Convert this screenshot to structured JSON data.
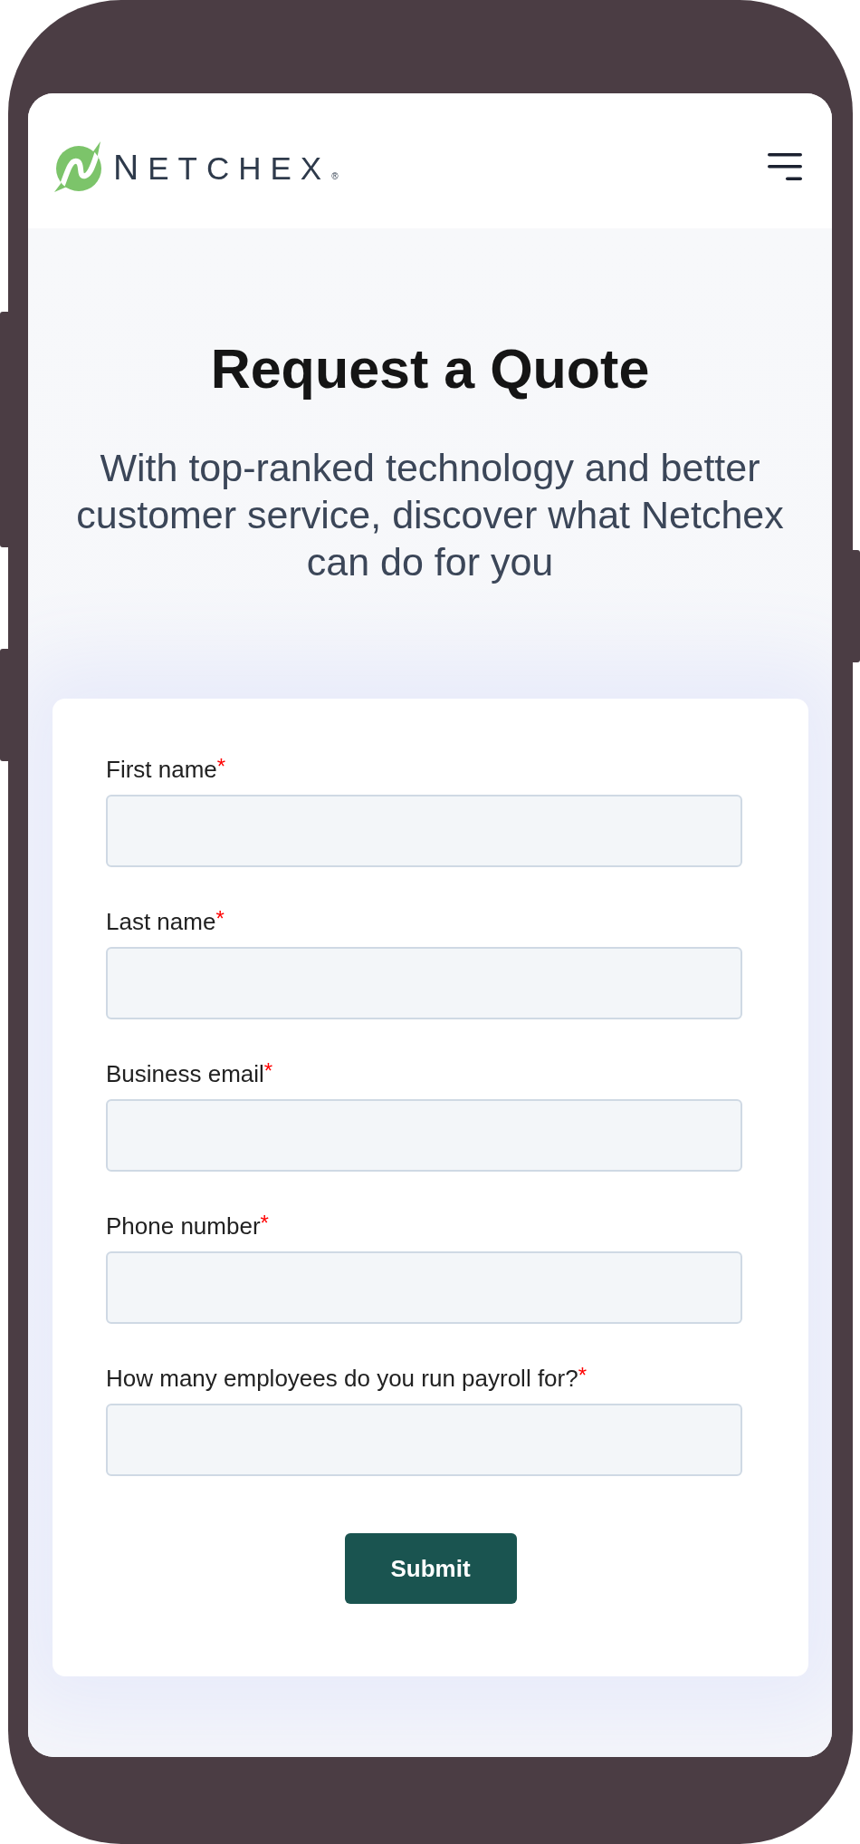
{
  "header": {
    "logo": {
      "wordmark": "NETCHEX",
      "registered_mark": "®"
    }
  },
  "hero": {
    "title": "Request a Quote",
    "subtitle": "With top-ranked technology and better customer service, discover what Netchex can do for you"
  },
  "form": {
    "fields": [
      {
        "label": "First name",
        "required_mark": "*"
      },
      {
        "label": "Last name",
        "required_mark": "*"
      },
      {
        "label": "Business email",
        "required_mark": "*"
      },
      {
        "label": "Phone number",
        "required_mark": "*"
      },
      {
        "label": "How many employees do you run payroll for?",
        "required_mark": "*"
      }
    ],
    "submit_button": {
      "label": "Submit"
    }
  }
}
